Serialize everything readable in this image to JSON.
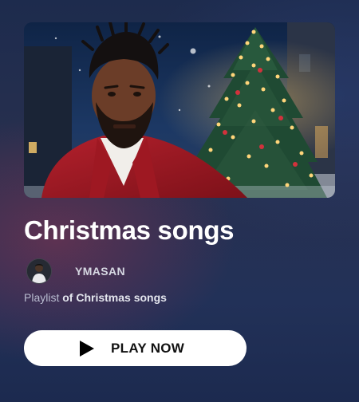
{
  "playlist": {
    "title": "Christmas songs",
    "author": "YMASAN",
    "description_type": "Playlist",
    "description_rest": "of Christmas songs",
    "play_label": "PLAY NOW"
  },
  "icons": {
    "play": "play-icon",
    "avatar": "avatar-image",
    "cover": "playlist-cover-image"
  },
  "colors": {
    "button_bg": "#ffffff",
    "button_text": "#111111",
    "title": "#ffffff",
    "background": "#223158"
  }
}
